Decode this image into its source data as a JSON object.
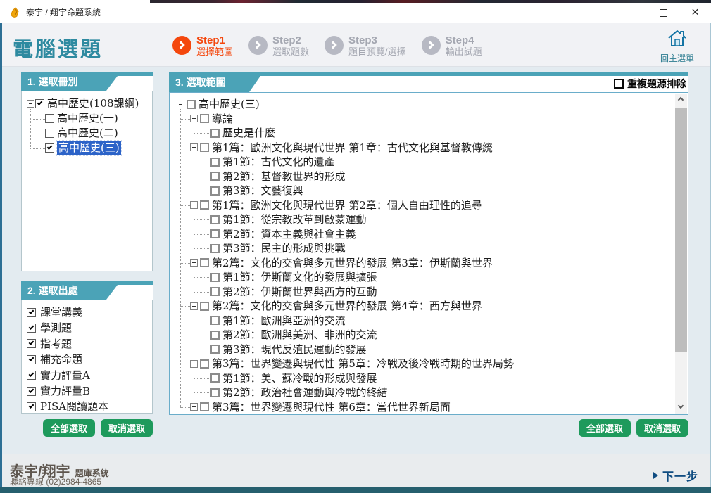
{
  "colors": {
    "accent_teal": "#4BA3B7",
    "title_teal": "#2E8AA0",
    "step_active_orange": "#F4470D",
    "step_inactive_gray": "#B7B9C3",
    "selection_blue": "#2C63C8",
    "button_green": "#1E9A5C",
    "next_blue": "#0F4C81",
    "bottom_strip_teal": "#265F6E"
  },
  "window": {
    "title": "泰宇 / 翔宇命題系統"
  },
  "header": {
    "page_title": "電腦選題",
    "steps": [
      {
        "name": "Step1",
        "label": "選擇範圍",
        "active": true
      },
      {
        "name": "Step2",
        "label": "選取題數",
        "active": false
      },
      {
        "name": "Step3",
        "label": "題目預覽/選擇",
        "active": false
      },
      {
        "name": "Step4",
        "label": "輸出試題",
        "active": false
      }
    ],
    "home_label": "回主選單"
  },
  "panel1": {
    "title": "1. 選取冊別",
    "tree": [
      {
        "label": "高中歷史(108課綱)",
        "level": 0,
        "expander": true,
        "checked": true,
        "selected": false
      },
      {
        "label": "高中歷史(一)",
        "level": 1,
        "expander": false,
        "checked": false,
        "selected": false
      },
      {
        "label": "高中歷史(二)",
        "level": 1,
        "expander": false,
        "checked": false,
        "selected": false
      },
      {
        "label": "高中歷史(三)",
        "level": 1,
        "expander": false,
        "checked": true,
        "selected": true
      }
    ]
  },
  "panel2": {
    "title": "2. 選取出處",
    "items": [
      {
        "label": "課堂講義",
        "checked": true
      },
      {
        "label": "學測題",
        "checked": true
      },
      {
        "label": "指考題",
        "checked": true
      },
      {
        "label": "補充命題",
        "checked": true
      },
      {
        "label": "實力評量A",
        "checked": true
      },
      {
        "label": "實力評量B",
        "checked": true
      },
      {
        "label": "PISA閱讀題本",
        "checked": true
      }
    ],
    "select_all": "全部選取",
    "deselect": "取消選取"
  },
  "panel3": {
    "title": "3. 選取範圍",
    "dedupe_label": "重複題源排除",
    "dedupe_checked": false,
    "select_all": "全部選取",
    "deselect": "取消選取",
    "tree": [
      {
        "label": "高中歷史(三)",
        "level": 0,
        "expander": true,
        "checked": false
      },
      {
        "label": "導論",
        "level": 1,
        "expander": true,
        "checked": false
      },
      {
        "label": "歷史是什麼",
        "level": 2,
        "expander": false,
        "checked": false
      },
      {
        "label": "第1篇：歐洲文化與現代世界 第1章：古代文化與基督教傳統",
        "level": 1,
        "expander": true,
        "checked": false
      },
      {
        "label": "第1節：古代文化的遺產",
        "level": 2,
        "expander": false,
        "checked": false
      },
      {
        "label": "第2節：基督教世界的形成",
        "level": 2,
        "expander": false,
        "checked": false
      },
      {
        "label": "第3節：文藝復興",
        "level": 2,
        "expander": false,
        "checked": false
      },
      {
        "label": "第1篇：歐洲文化與現代世界 第2章：個人自由理性的追尋",
        "level": 1,
        "expander": true,
        "checked": false
      },
      {
        "label": "第1節：從宗教改革到啟蒙運動",
        "level": 2,
        "expander": false,
        "checked": false
      },
      {
        "label": "第2節：資本主義與社會主義",
        "level": 2,
        "expander": false,
        "checked": false
      },
      {
        "label": "第3節：民主的形成與挑戰",
        "level": 2,
        "expander": false,
        "checked": false
      },
      {
        "label": "第2篇：文化的交會與多元世界的發展 第3章：伊斯蘭與世界",
        "level": 1,
        "expander": true,
        "checked": false
      },
      {
        "label": "第1節：伊斯蘭文化的發展與擴張",
        "level": 2,
        "expander": false,
        "checked": false
      },
      {
        "label": "第2節：伊斯蘭世界與西方的互動",
        "level": 2,
        "expander": false,
        "checked": false
      },
      {
        "label": "第2篇：文化的交會與多元世界的發展 第4章：西方與世界",
        "level": 1,
        "expander": true,
        "checked": false
      },
      {
        "label": "第1節：歐洲與亞洲的交流",
        "level": 2,
        "expander": false,
        "checked": false
      },
      {
        "label": "第2節：歐洲與美洲、非洲的交流",
        "level": 2,
        "expander": false,
        "checked": false
      },
      {
        "label": "第3節：現代反殖民運動的發展",
        "level": 2,
        "expander": false,
        "checked": false
      },
      {
        "label": "第3篇：世界變遷與現代性 第5章：冷戰及後冷戰時期的世界局勢",
        "level": 1,
        "expander": true,
        "checked": false
      },
      {
        "label": "第1節：美、蘇冷戰的形成與發展",
        "level": 2,
        "expander": false,
        "checked": false
      },
      {
        "label": "第2節：政治社會運動與冷戰的終結",
        "level": 2,
        "expander": false,
        "checked": false
      },
      {
        "label": "第3篇：世界變遷與現代性 第6章：當代世界新局面",
        "level": 1,
        "expander": true,
        "checked": false
      }
    ]
  },
  "footer": {
    "brand": "泰宇/翔宇",
    "brand_suffix": "題庫系統",
    "contact": "聯絡專線 (02)2984-4865",
    "next_label": "下一步"
  }
}
